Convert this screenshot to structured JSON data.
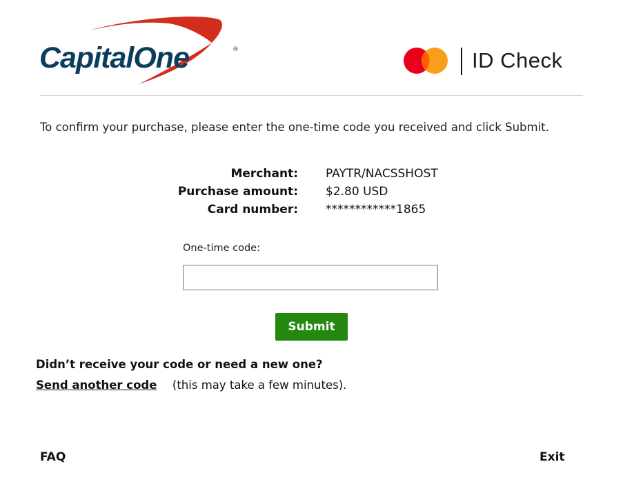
{
  "header": {
    "brand_logo_text": "CapitalOne",
    "id_check_label": "ID Check"
  },
  "instructions": "To confirm your purchase, please enter the one-time code you received and click Submit.",
  "details": [
    {
      "label": "Merchant:",
      "value": "PAYTR/NACSSHOST"
    },
    {
      "label": "Purchase amount:",
      "value": "$2.80 USD"
    },
    {
      "label": "Card number:",
      "value": "************1865"
    }
  ],
  "otp": {
    "label": "One-time code:",
    "value": "",
    "placeholder": ""
  },
  "submit_label": "Submit",
  "resend": {
    "question": "Didn’t receive your code or need a new one?",
    "link_label": "Send another code",
    "note": "(this may take a few minutes)."
  },
  "footer": {
    "faq_label": "FAQ",
    "exit_label": "Exit"
  },
  "colors": {
    "capital_one_navy": "#0b3e5c",
    "capital_one_red": "#d22e1e",
    "submit_green": "#24870f",
    "mastercard_red": "#eb001b",
    "mastercard_orange": "#f79e1b"
  }
}
